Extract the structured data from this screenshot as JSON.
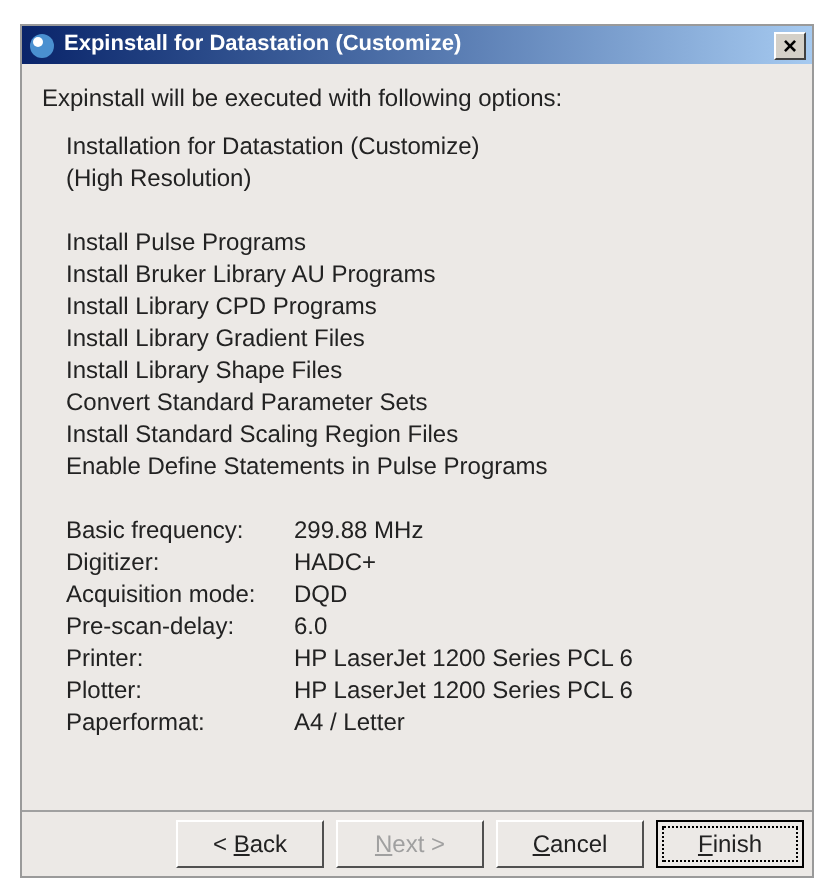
{
  "window": {
    "title": "Expinstall for Datastation (Customize)",
    "close": "×"
  },
  "intro": "Expinstall will be executed with following options:",
  "installation": [
    "Installation for Datastation (Customize)",
    "(High Resolution)"
  ],
  "options": [
    "Install Pulse Programs",
    "Install Bruker Library AU Programs",
    "Install Library CPD Programs",
    "Install Library Gradient Files",
    "Install Library Shape Files",
    "Convert Standard Parameter Sets",
    "Install Standard Scaling Region Files",
    "Enable Define Statements in Pulse Programs"
  ],
  "settings": [
    {
      "label": "Basic frequency:",
      "value": "299.88 MHz"
    },
    {
      "label": "Digitizer:",
      "value": "HADC+"
    },
    {
      "label": "Acquisition mode:",
      "value": "DQD"
    },
    {
      "label": "Pre-scan-delay:",
      "value": "6.0"
    },
    {
      "label": "Printer:",
      "value": "HP LaserJet 1200 Series PCL 6"
    },
    {
      "label": "Plotter:",
      "value": "HP LaserJet 1200 Series PCL 6"
    },
    {
      "label": "Paperformat:",
      "value": "A4 / Letter"
    }
  ],
  "buttons": [
    {
      "before": "< ",
      "mnemonic": "B",
      "after": "ack",
      "disabled": false,
      "default": false
    },
    {
      "mnemonic": "N",
      "after": "ext >",
      "disabled": true,
      "default": false
    },
    {
      "mnemonic": "C",
      "after": "ancel",
      "disabled": false,
      "default": false
    },
    {
      "mnemonic": "F",
      "after": "inish",
      "disabled": false,
      "default": true
    }
  ]
}
